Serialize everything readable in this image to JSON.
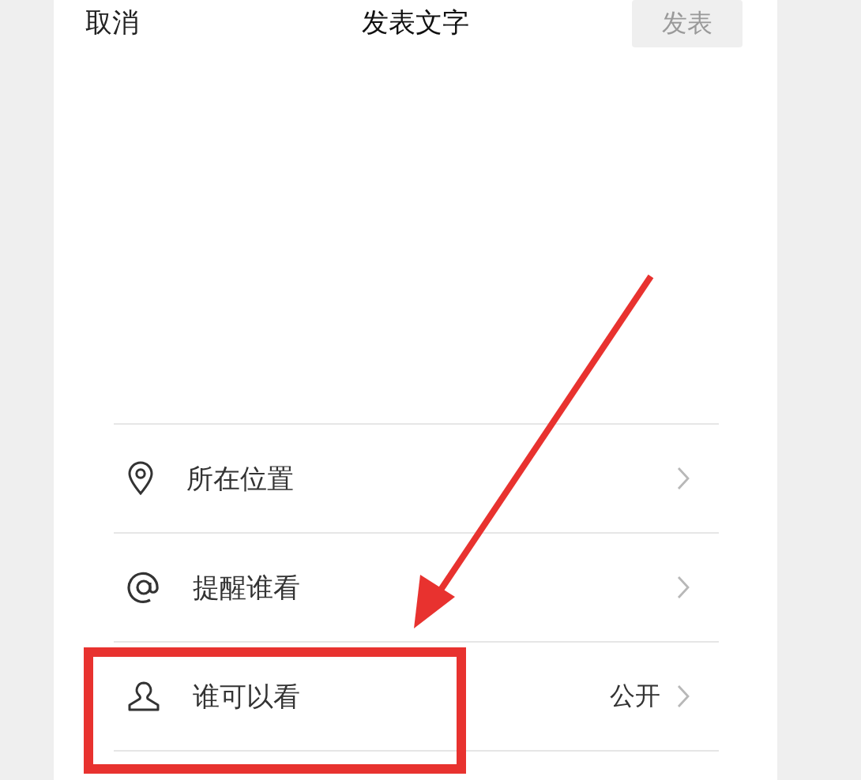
{
  "header": {
    "cancel": "取消",
    "title": "发表文字",
    "publish": {
      "label": "发表",
      "disabled": true
    }
  },
  "options": [
    {
      "kind": "location",
      "label": "所在位置",
      "highlighted": false
    },
    {
      "kind": "mention",
      "label": "提醒谁看",
      "highlighted": false
    },
    {
      "kind": "audience",
      "label": "谁可以看",
      "value": "公开",
      "highlighted": true
    }
  ]
}
